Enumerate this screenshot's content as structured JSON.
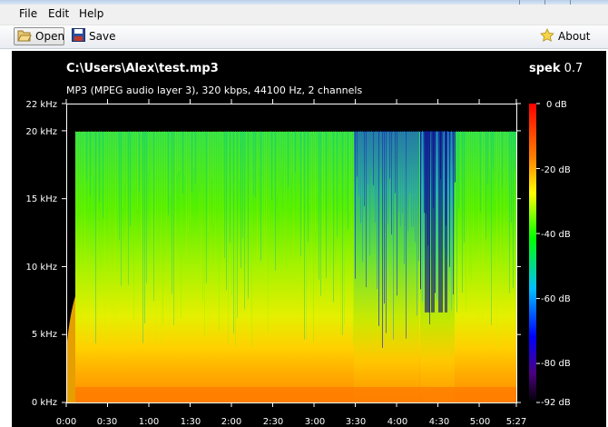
{
  "menu": {
    "file": "File",
    "edit": "Edit",
    "help": "Help"
  },
  "toolbar": {
    "open_label": "Open",
    "save_label": "Save",
    "about_label": "About",
    "open_icon": "folder-open-icon",
    "save_icon": "floppy-disk-icon",
    "about_icon": "star-icon"
  },
  "viewer": {
    "file_path": "C:\\Users\\Alex\\test.mp3",
    "app_name": "spek",
    "app_version": "0.7",
    "audio_info": "MP3 (MPEG audio layer 3), 320 kbps, 44100 Hz, 2 channels"
  },
  "chart_data": {
    "type": "heatmap",
    "x_axis": {
      "ticks": [
        "0:00",
        "0:30",
        "1:00",
        "1:30",
        "2:00",
        "2:30",
        "3:00",
        "3:30",
        "4:00",
        "4:30",
        "5:00",
        "5:27"
      ],
      "range": [
        "0:00",
        "5:27"
      ]
    },
    "y_axis": {
      "ticks": [
        "0 kHz",
        "5 kHz",
        "10 kHz",
        "15 kHz",
        "20 kHz",
        "22 kHz"
      ],
      "range": [
        0,
        22
      ]
    },
    "color_scale": {
      "ticks": [
        "0 dB",
        "-20 dB",
        "-40 dB",
        "-60 dB",
        "-80 dB",
        "-92 dB"
      ],
      "range": [
        0,
        -92
      ],
      "colors": [
        "#ff0000",
        "#ff8000",
        "#ffff00",
        "#00ff00",
        "#00bfff",
        "#0000ff",
        "#4b0082",
        "#000000"
      ]
    },
    "cutoff_khz": 20
  }
}
